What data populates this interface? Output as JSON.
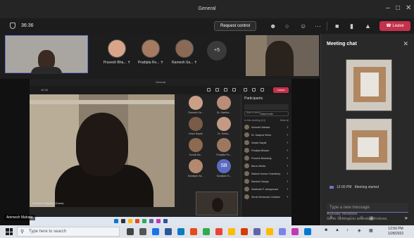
{
  "window": {
    "title": "General",
    "minimize": "–",
    "maximize": "□",
    "close": "✕"
  },
  "topbar": {
    "timer": "36:36",
    "request_control": "Request control",
    "more": "···",
    "leave": "Leave"
  },
  "participants_row": {
    "tiles": [
      {
        "name": "Pravesh Bha...",
        "color": "#d9a58a"
      },
      {
        "name": "Pradipta Ro...",
        "color": "#a57a60"
      },
      {
        "name": "Ramesh Sa...",
        "color": "#8b6a55"
      }
    ],
    "more_count": "+5"
  },
  "stage": {
    "inner_title": "General",
    "inner_timer": "46:36",
    "inner_leave": "Leave",
    "video_caption": "Animesh Mahata (Guest)",
    "grid": [
      {
        "name": "Ramesh Sa...",
        "color": "#c9a086"
      },
      {
        "name": "Dr. Swetha...",
        "color": "#b98d77"
      },
      {
        "name": "Ishan Nayak",
        "color": "#7a5a48"
      },
      {
        "name": "Dr. Sarita...",
        "color": "#c49a85"
      },
      {
        "name": "Souvik Ba...",
        "color": "#8d6a52"
      },
      {
        "name": "Pradipta Ro...",
        "color": "#9d7860"
      },
      {
        "name": "Sukalyan Sa...",
        "color": "#b38a70"
      },
      {
        "name": "Sandipan B...",
        "initials": "SB",
        "color": "#5b6bc0"
      }
    ],
    "panel": {
      "title": "Participants",
      "search": "Type a name",
      "invite": "Share invite",
      "section": "In this meeting (13)",
      "mute_all": "Mute all",
      "people": [
        "Animesh Mahata",
        "Dr. Swapna Sinha",
        "Ishaan Nayak",
        "Pradipta Biswas",
        "Pravesh Bhardwaj",
        "Barun Mehta",
        "Rakesh Kumar Chaudhary",
        "Ramesh Sanjay",
        "Siddharth P. Ashapurwar",
        "Shruti Mohanram Chaitree"
      ]
    }
  },
  "presenter_name": "Animesh Mahata",
  "chat": {
    "title": "Meeting chat",
    "close": "✕",
    "meeting_started_time": "12:00 PM",
    "meeting_started_text": "Meeting started",
    "compose_placeholder": "Type a new message",
    "activate_line1": "Activate Windows",
    "activate_line2": "Go to Settings to activate Windows."
  },
  "taskbar": {
    "search_placeholder": "Type here to search",
    "time": "12:50 PM",
    "date": "1/28/2022",
    "app_colors": [
      "#444",
      "#555",
      "#1a73e8",
      "#2b579a",
      "#0a7cc1",
      "#e44c1c",
      "#33a852",
      "#ea4335",
      "#fbbc05",
      "#d83b01",
      "#6264a7",
      "#ffb900",
      "#7b83eb",
      "#c239b3",
      "#0078d4"
    ]
  }
}
